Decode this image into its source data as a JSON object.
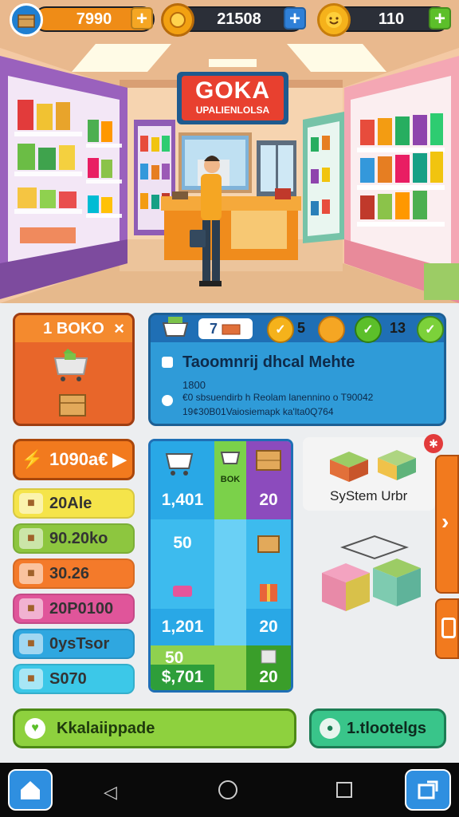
{
  "topbar": {
    "res1": {
      "value": "7990",
      "icon": "crate-icon"
    },
    "res2": {
      "value": "21508",
      "icon": "coin-icon"
    },
    "res3": {
      "value": "110",
      "icon": "smiley-icon"
    },
    "plus": "+"
  },
  "scene": {
    "sign_title": "GOKA",
    "sign_subtitle": "UPALIENLOLSA"
  },
  "shop_card": {
    "title": "1 BOKO",
    "close": "×"
  },
  "info_card": {
    "badge1": "7",
    "badge2": "5",
    "badge3": "13",
    "title": "Taoomnrij dhcal Mehte",
    "line1": "1800",
    "line2": "€0 sbsuendirb h Reolam lanennino o T90042",
    "line3": "19¢30B01Vaiosiemapk ka'lta0Q764"
  },
  "orange_button": "1090a€",
  "list_items": [
    {
      "label": "20Ale",
      "icon": "gem-icon",
      "color": "#f5e44a"
    },
    {
      "label": "90.20ko",
      "icon": "box-icon",
      "color": "#8dc63f"
    },
    {
      "label": "30.26",
      "icon": "gift-icon",
      "color": "#f47a2a"
    },
    {
      "label": "20P0100",
      "icon": "shield-icon",
      "color": "#e0559a"
    },
    {
      "label": "0ysTsor",
      "icon": "star-icon",
      "color": "#2fa7e0"
    },
    {
      "label": "S070",
      "icon": "wrench-icon",
      "color": "#3cc8e8"
    }
  ],
  "grid": {
    "header_label": "BOK",
    "v1": "1,401",
    "v2": "20",
    "v3": "50",
    "v4": "1,201",
    "v5": "20",
    "v6": "50",
    "v7": "$,701",
    "v8": "20"
  },
  "preview": {
    "label": "SyStem Urbr"
  },
  "buttons": {
    "left": "Kkalaiippade",
    "right": "1.tlootelgs"
  },
  "navbar": {
    "home_label": "Home"
  }
}
